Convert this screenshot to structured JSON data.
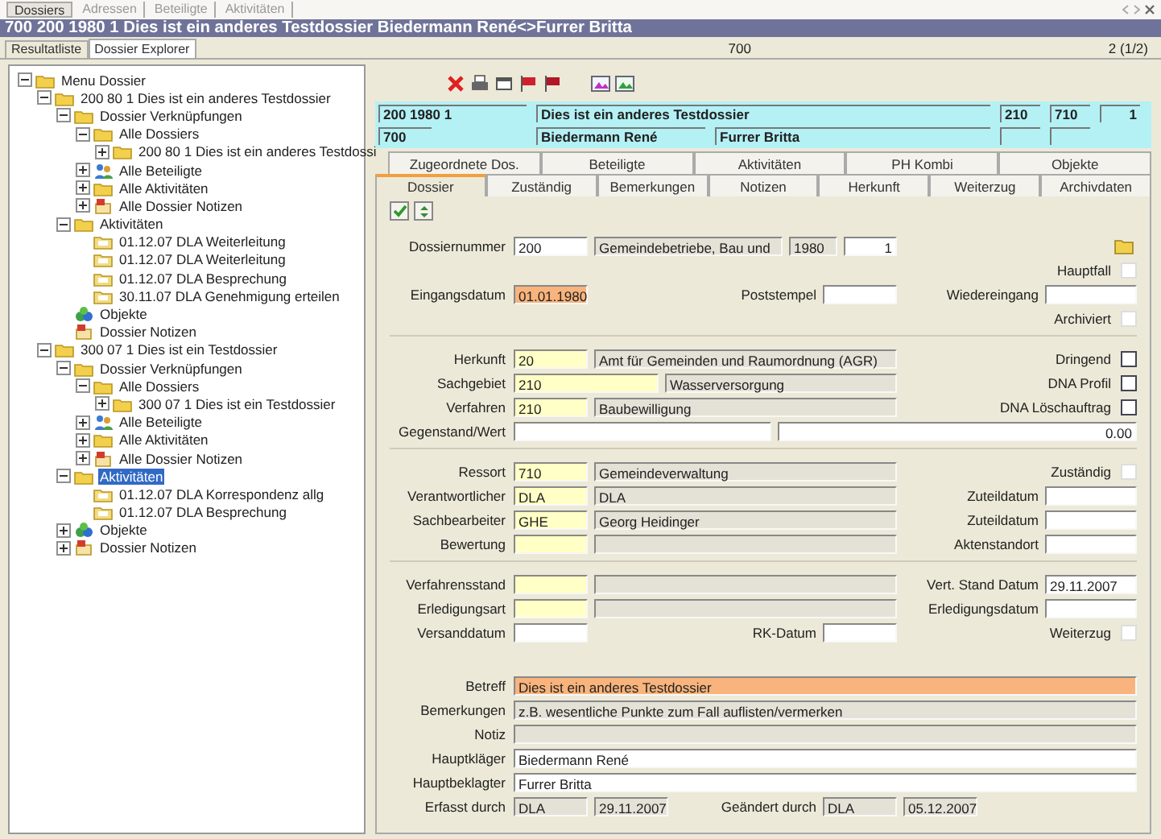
{
  "app_tabs": [
    {
      "label": "Dossiers",
      "selected": true
    },
    {
      "label": "Adressen",
      "selected": false
    },
    {
      "label": "Beteiligte",
      "selected": false
    },
    {
      "label": "Aktivitäten",
      "selected": false
    }
  ],
  "title": "700 200 1980 1 Dies ist ein anderes Testdossier Biedermann René<>Furrer Britta",
  "view_tabs": [
    {
      "label": "Resultatliste",
      "selected": false
    },
    {
      "label": "Dossier Explorer",
      "selected": true
    }
  ],
  "record": "700",
  "count": "2 (1/2)",
  "tree": [
    {
      "label": "Menu Dossier",
      "kind": "folder",
      "expanded": true,
      "selected": false,
      "children": [
        {
          "label": "200 80 1 Dies ist ein anderes Testdossier",
          "kind": "folder",
          "expanded": true,
          "selected": false,
          "children": [
            {
              "label": "Dossier Verknüpfungen",
              "kind": "folder",
              "expanded": true,
              "selected": false,
              "children": [
                {
                  "label": "Alle Dossiers",
                  "kind": "folder",
                  "expanded": true,
                  "selected": false,
                  "children": [
                    {
                      "label": "200 80 1 Dies ist ein anderes Testdossi",
                      "kind": "folder",
                      "expanded": false,
                      "selected": false
                    }
                  ]
                },
                {
                  "label": "Alle Beteiligte",
                  "kind": "people",
                  "expanded": false,
                  "selected": false
                },
                {
                  "label": "Alle Aktivitäten",
                  "kind": "folder",
                  "expanded": false,
                  "selected": false
                },
                {
                  "label": "Alle Dossier Notizen",
                  "kind": "notes",
                  "expanded": false,
                  "selected": false
                }
              ]
            },
            {
              "label": "Aktivitäten",
              "kind": "folder",
              "expanded": true,
              "selected": false,
              "children": [
                {
                  "label": "01.12.07 DLA Weiterleitung",
                  "kind": "entry",
                  "selected": false
                },
                {
                  "label": "01.12.07 DLA Weiterleitung",
                  "kind": "entry",
                  "selected": false
                },
                {
                  "label": "01.12.07 DLA Besprechung",
                  "kind": "entry",
                  "selected": false
                },
                {
                  "label": "30.11.07 DLA Genehmigung erteilen",
                  "kind": "entry",
                  "selected": false
                }
              ]
            },
            {
              "label": "Objekte",
              "kind": "objects",
              "selected": false
            },
            {
              "label": "Dossier Notizen",
              "kind": "notes",
              "selected": false
            }
          ]
        },
        {
          "label": "300 07 1 Dies ist ein Testdossier",
          "kind": "folder",
          "expanded": true,
          "selected": false,
          "children": [
            {
              "label": "Dossier Verknüpfungen",
              "kind": "folder",
              "expanded": true,
              "selected": false,
              "children": [
                {
                  "label": "Alle Dossiers",
                  "kind": "folder",
                  "expanded": true,
                  "selected": false,
                  "children": [
                    {
                      "label": "300 07 1 Dies ist ein Testdossier",
                      "kind": "folder",
                      "expanded": false,
                      "selected": false
                    }
                  ]
                },
                {
                  "label": "Alle Beteiligte",
                  "kind": "people",
                  "expanded": false,
                  "selected": false
                },
                {
                  "label": "Alle Aktivitäten",
                  "kind": "folder",
                  "expanded": false,
                  "selected": false
                },
                {
                  "label": "Alle Dossier Notizen",
                  "kind": "notes",
                  "expanded": false,
                  "selected": false
                }
              ]
            },
            {
              "label": "Aktivitäten",
              "kind": "folder",
              "expanded": true,
              "selected": true,
              "children": [
                {
                  "label": "01.12.07 DLA Korrespondenz allg",
                  "kind": "entry",
                  "selected": false
                },
                {
                  "label": "01.12.07 DLA Besprechung",
                  "kind": "entry",
                  "selected": false
                }
              ]
            },
            {
              "label": "Objekte",
              "kind": "objects",
              "expanded": false,
              "selected": false
            },
            {
              "label": "Dossier Notizen",
              "kind": "notes",
              "expanded": false,
              "selected": false
            }
          ]
        }
      ]
    }
  ],
  "header": [
    [
      {
        "value": "200 1980 1"
      },
      {
        "value": "Dies ist ein anderes Testdossier"
      },
      {
        "value": "210"
      },
      {
        "value": "710"
      },
      {
        "value": "1"
      }
    ],
    [
      {
        "value": "700"
      },
      {
        "value": "Biedermann René"
      },
      {
        "value": "Furrer Britta"
      }
    ]
  ],
  "tabs": [
    [
      {
        "label": "Zugeordnete Dos.",
        "selected": false
      },
      {
        "label": "Beteiligte",
        "selected": false
      },
      {
        "label": "Aktivitäten",
        "selected": false
      },
      {
        "label": "PH Kombi",
        "selected": false
      },
      {
        "label": "Objekte",
        "selected": false
      }
    ],
    [
      {
        "label": "Dossier",
        "selected": true
      },
      {
        "label": "Zuständig",
        "selected": false
      },
      {
        "label": "Bemerkungen",
        "selected": false
      },
      {
        "label": "Notizen",
        "selected": false
      },
      {
        "label": "Herkunft",
        "selected": false
      },
      {
        "label": "Weiterzug",
        "selected": false
      },
      {
        "label": "Archivdaten",
        "selected": false
      }
    ]
  ],
  "form": [
    {
      "rows": [
        {
          "left": [
            {
              "kind": "label",
              "text": "Dossiernummer"
            },
            {
              "kind": "input",
              "value": "200"
            },
            {
              "kind": "lookup",
              "value": "Gemeindebetriebe, Bau und"
            },
            {
              "kind": "lookup",
              "value": "1980"
            },
            {
              "kind": "input",
              "value": "1"
            }
          ],
          "right": [
            {
              "kind": "folder"
            }
          ]
        },
        {
          "left": [],
          "right": [
            {
              "kind": "label",
              "text": "Hauptfall"
            },
            {
              "kind": "check",
              "checked": false,
              "disabled": true
            }
          ]
        },
        {
          "left": [
            {
              "kind": "label",
              "text": "Eingangsdatum"
            },
            {
              "kind": "highlight",
              "value": "01.01.1980"
            },
            {
              "kind": "label",
              "text": "Poststempel"
            },
            {
              "kind": "input"
            }
          ],
          "right": [
            {
              "kind": "label",
              "text": "Wiedereingang"
            },
            {
              "kind": "input"
            }
          ]
        },
        {
          "left": [],
          "right": [
            {
              "kind": "label",
              "text": "Archiviert"
            },
            {
              "kind": "check",
              "checked": false,
              "disabled": true
            }
          ]
        }
      ]
    },
    {
      "rows": [
        {
          "left": [
            {
              "kind": "label",
              "text": "Herkunft"
            },
            {
              "kind": "code",
              "value": "20"
            },
            {
              "kind": "lookup",
              "value": "Amt für Gemeinden und Raumordnung (AGR)"
            }
          ],
          "right": [
            {
              "kind": "label",
              "text": "Dringend"
            },
            {
              "kind": "check",
              "checked": false,
              "disabled": false
            }
          ]
        },
        {
          "left": [
            {
              "kind": "label",
              "text": "Sachgebiet"
            },
            {
              "kind": "code",
              "value": "210"
            },
            {
              "kind": "lookup",
              "value": "Wasserversorgung"
            }
          ],
          "right": [
            {
              "kind": "label",
              "text": "DNA Profil"
            },
            {
              "kind": "check",
              "checked": false,
              "disabled": false
            }
          ]
        },
        {
          "left": [
            {
              "kind": "label",
              "text": "Verfahren"
            },
            {
              "kind": "code",
              "value": "210"
            },
            {
              "kind": "lookup",
              "value": "Baubewilligung"
            }
          ],
          "right": [
            {
              "kind": "label",
              "text": "DNA Löschauftrag"
            },
            {
              "kind": "check",
              "checked": false,
              "disabled": false
            }
          ]
        },
        {
          "left": [
            {
              "kind": "label",
              "text": "Gegenstand/Wert"
            },
            {
              "kind": "input"
            },
            {
              "kind": "input",
              "value": "0.00"
            }
          ]
        }
      ]
    },
    {
      "rows": [
        {
          "left": [
            {
              "kind": "label",
              "text": "Ressort"
            },
            {
              "kind": "code",
              "value": "710"
            },
            {
              "kind": "lookup",
              "value": "Gemeindeverwaltung"
            }
          ],
          "right": [
            {
              "kind": "label",
              "text": "Zuständig"
            },
            {
              "kind": "check",
              "checked": false,
              "disabled": true
            }
          ]
        },
        {
          "left": [
            {
              "kind": "label",
              "text": "Verantwortlicher"
            },
            {
              "kind": "code",
              "value": "DLA"
            },
            {
              "kind": "lookup",
              "value": "DLA"
            }
          ],
          "right": [
            {
              "kind": "label",
              "text": "Zuteildatum"
            },
            {
              "kind": "input"
            }
          ]
        },
        {
          "left": [
            {
              "kind": "label",
              "text": "Sachbearbeiter"
            },
            {
              "kind": "code",
              "value": "GHE"
            },
            {
              "kind": "lookup",
              "value": "Georg Heidinger"
            }
          ],
          "right": [
            {
              "kind": "label",
              "text": "Zuteildatum"
            },
            {
              "kind": "input"
            }
          ]
        },
        {
          "left": [
            {
              "kind": "label",
              "text": "Bewertung"
            },
            {
              "kind": "code"
            },
            {
              "kind": "lookup"
            }
          ],
          "right": [
            {
              "kind": "label",
              "text": "Aktenstandort"
            },
            {
              "kind": "input"
            }
          ]
        }
      ]
    },
    {
      "rows": [
        {
          "left": [
            {
              "kind": "label",
              "text": "Verfahrensstand"
            },
            {
              "kind": "code"
            },
            {
              "kind": "lookup"
            }
          ],
          "right": [
            {
              "kind": "label",
              "text": "Vert. Stand Datum"
            },
            {
              "kind": "input",
              "value": "29.11.2007"
            }
          ]
        },
        {
          "left": [
            {
              "kind": "label",
              "text": "Erledigungsart"
            },
            {
              "kind": "code"
            },
            {
              "kind": "lookup"
            }
          ],
          "right": [
            {
              "kind": "label",
              "text": "Erledigungsdatum"
            },
            {
              "kind": "input"
            }
          ]
        },
        {
          "left": [
            {
              "kind": "label",
              "text": "Versanddatum"
            },
            {
              "kind": "input"
            },
            {
              "kind": "label",
              "text": "RK-Datum"
            },
            {
              "kind": "input"
            }
          ],
          "right": [
            {
              "kind": "label",
              "text": "Weiterzug"
            },
            {
              "kind": "check",
              "checked": false,
              "disabled": true
            }
          ]
        }
      ]
    },
    {
      "rows": [
        {
          "left": [
            {
              "kind": "label",
              "text": "Betreff"
            },
            {
              "kind": "highlight",
              "value": "Dies ist ein anderes Testdossier"
            }
          ]
        },
        {
          "left": [
            {
              "kind": "label",
              "text": "Bemerkungen"
            },
            {
              "kind": "lookup",
              "value": "z.B. wesentliche Punkte zum Fall auflisten/vermerken"
            }
          ]
        },
        {
          "left": [
            {
              "kind": "label",
              "text": "Notiz"
            },
            {
              "kind": "lookup"
            }
          ]
        },
        {
          "left": [
            {
              "kind": "label",
              "text": "Hauptkläger"
            },
            {
              "kind": "input",
              "value": "Biedermann René"
            }
          ]
        },
        {
          "left": [
            {
              "kind": "label",
              "text": "Hauptbeklagter"
            },
            {
              "kind": "input",
              "value": "Furrer Britta"
            }
          ]
        },
        {
          "left": [
            {
              "kind": "label",
              "text": "Erfasst durch"
            },
            {
              "kind": "lookup",
              "value": "DLA"
            },
            {
              "kind": "lookup",
              "value": "29.11.2007"
            },
            {
              "kind": "label",
              "text": "Geändert durch"
            },
            {
              "kind": "lookup",
              "value": "DLA"
            },
            {
              "kind": "lookup",
              "value": "05.12.2007"
            }
          ]
        }
      ]
    }
  ]
}
